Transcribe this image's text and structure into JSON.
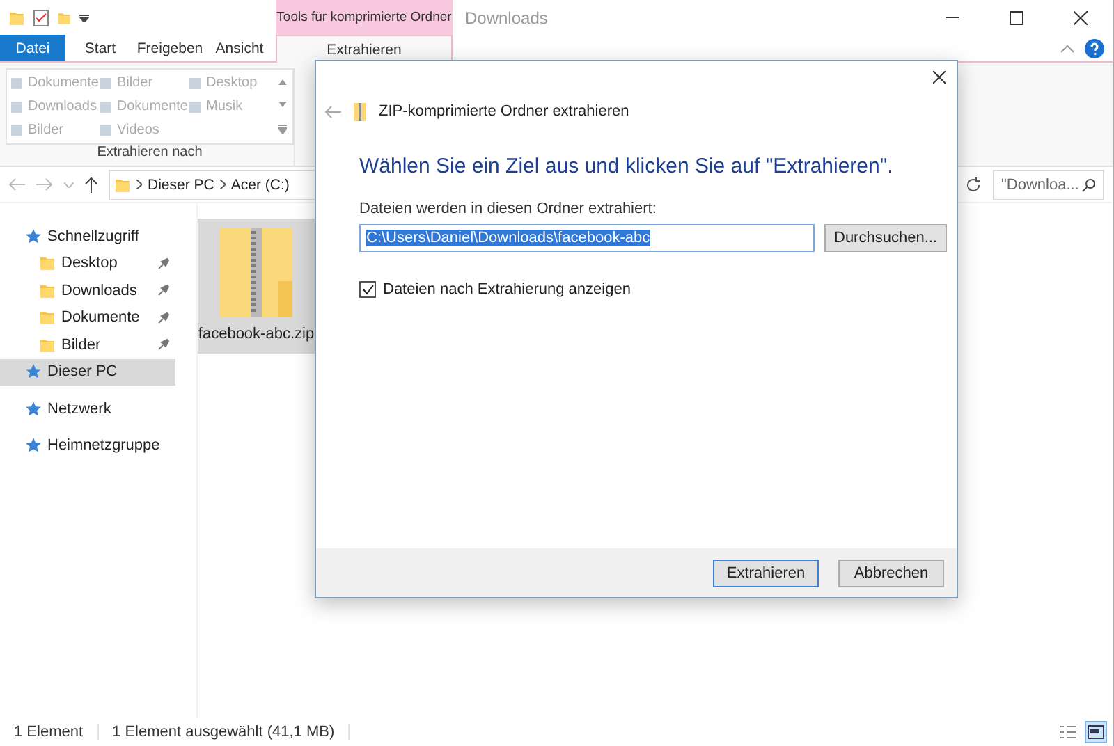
{
  "title_bar": {
    "context_header": "Tools für komprimierte Ordner",
    "title": "Downloads"
  },
  "ribbon_tabs": [
    {
      "label": "Datei",
      "kind": "file",
      "selected": false
    },
    {
      "label": "Start",
      "kind": "normal",
      "selected": false
    },
    {
      "label": "Freigeben",
      "kind": "normal",
      "selected": false
    },
    {
      "label": "Ansicht",
      "kind": "normal",
      "selected": false
    },
    {
      "label": "Extrahieren",
      "kind": "context",
      "selected": true
    }
  ],
  "ribbon_group": {
    "label": "Extrahieren nach",
    "items": [
      {
        "label": "Dokumente",
        "disabled": true
      },
      {
        "label": "Bilder",
        "disabled": true
      },
      {
        "label": "Desktop",
        "disabled": true
      },
      {
        "label": "Downloads",
        "disabled": true
      },
      {
        "label": "Dokumente",
        "disabled": true
      },
      {
        "label": "Musik",
        "disabled": true
      },
      {
        "label": "Bilder",
        "disabled": true
      },
      {
        "label": "Videos",
        "disabled": true
      }
    ]
  },
  "address_bar": {
    "breadcrumb": [
      "Dieser PC",
      "Acer (C:)"
    ],
    "search_placeholder": "\"Downloa..."
  },
  "navigation": [
    {
      "label": "Schnellzugriff",
      "selected": false,
      "children": [
        {
          "label": "Desktop",
          "selected": false
        },
        {
          "label": "Downloads",
          "selected": false
        },
        {
          "label": "Dokumente",
          "selected": false
        },
        {
          "label": "Bilder",
          "selected": false
        }
      ]
    },
    {
      "label": "Dieser PC",
      "selected": true
    },
    {
      "label": "Netzwerk",
      "selected": false
    },
    {
      "label": "Heimnetzgruppe",
      "selected": false
    }
  ],
  "files": [
    {
      "name": "facebook-abc.zip",
      "selected": true
    }
  ],
  "status_bar": [
    "1 Element",
    "1 Element ausgewählt (41,1 MB)"
  ],
  "dialog": {
    "title": "ZIP-komprimierte Ordner extrahieren",
    "heading": "Wählen Sie ein Ziel aus und klicken Sie auf \"Extrahieren\".",
    "field_label": "Dateien werden in diesen Ordner extrahiert:",
    "path": "C:\\Users\\Daniel\\Downloads\\facebook-abc",
    "browse": "Durchsuchen...",
    "checkbox": {
      "label": "Dateien nach Extrahierung anzeigen",
      "checked": true
    },
    "buttons": [
      {
        "label": "Extrahieren",
        "default": true
      },
      {
        "label": "Abbrechen",
        "default": false
      }
    ]
  }
}
